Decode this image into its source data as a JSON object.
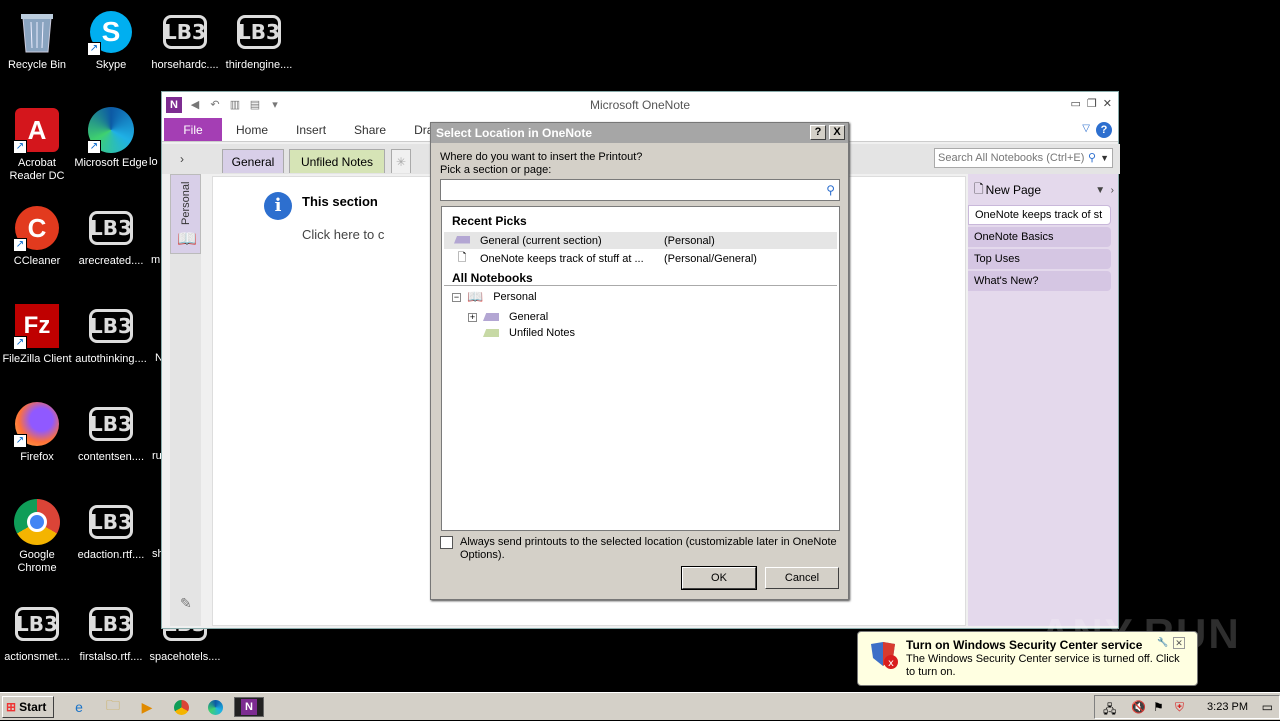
{
  "desktop": {
    "icons": [
      {
        "label": "Recycle Bin",
        "icon": "recycle-bin-icon"
      },
      {
        "label": "Skype",
        "icon": "skype-icon"
      },
      {
        "label": "horsehardc....",
        "icon": "lb3-file-icon"
      },
      {
        "label": "thirdengine....",
        "icon": "lb3-file-icon"
      },
      {
        "label": "Acrobat Reader DC",
        "icon": "acrobat-icon"
      },
      {
        "label": "Microsoft Edge",
        "icon": "edge-icon"
      },
      {
        "label": "CCleaner",
        "icon": "ccleaner-icon"
      },
      {
        "label": "arecreated....",
        "icon": "lb3-file-icon"
      },
      {
        "label": "FileZilla Client",
        "icon": "filezilla-icon"
      },
      {
        "label": "autothinking....",
        "icon": "lb3-file-icon"
      },
      {
        "label": "Firefox",
        "icon": "firefox-icon"
      },
      {
        "label": "contentsen....",
        "icon": "lb3-file-icon"
      },
      {
        "label": "Google Chrome",
        "icon": "chrome-icon"
      },
      {
        "label": "edaction.rtf....",
        "icon": "lb3-file-icon"
      },
      {
        "label": "actionsmet....",
        "icon": "lb3-file-icon"
      },
      {
        "label": "firstalso.rtf....",
        "icon": "lb3-file-icon"
      },
      {
        "label": "spacehotels....",
        "icon": "lb3-file-icon"
      }
    ],
    "partial_labels": [
      "lo",
      "m",
      "N",
      "ru",
      "sh"
    ]
  },
  "onenote": {
    "title": "Microsoft OneNote",
    "ribbon_tabs": [
      "File",
      "Home",
      "Insert",
      "Share",
      "Draw"
    ],
    "section_tabs": [
      "General",
      "Unfiled Notes"
    ],
    "search_placeholder": "Search All Notebooks (Ctrl+E)",
    "notebook_name": "Personal",
    "info_title": "This section",
    "info_sub": "Click here to c",
    "new_page": "New Page",
    "pages": [
      "OneNote keeps track of st",
      "OneNote Basics",
      "Top Uses",
      "What's New?"
    ]
  },
  "dialog": {
    "title": "Select Location in OneNote",
    "help_label": "?",
    "close_label": "X",
    "prompt1": "Where do you want to insert the Printout?",
    "prompt2": "Pick a section or page:",
    "recent_header": "Recent Picks",
    "recent": [
      {
        "name": "General (current section)",
        "location": "(Personal)"
      },
      {
        "name": "OneNote keeps track of stuff at ...",
        "location": "(Personal/General)"
      }
    ],
    "all_header": "All Notebooks",
    "tree": {
      "notebook": "Personal",
      "sections": [
        "General",
        "Unfiled Notes"
      ]
    },
    "checkbox_label": "Always send printouts to the selected location (customizable later in OneNote Options).",
    "ok": "OK",
    "cancel": "Cancel"
  },
  "balloon": {
    "title": "Turn on Windows Security Center service",
    "body": "The Windows Security Center service is turned off. Click to turn on."
  },
  "watermark": "ANY.RUN",
  "taskbar": {
    "start": "Start",
    "clock": "3:23 PM"
  },
  "colors": {
    "onenote_purple": "#a43eb4",
    "section_general": "#d8cfe8",
    "section_unfiled": "#d6e4b6",
    "balloon_bg": "#ffffe1"
  }
}
